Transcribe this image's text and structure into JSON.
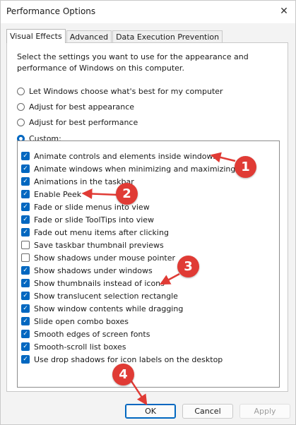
{
  "window": {
    "title": "Performance Options",
    "close_glyph": "✕"
  },
  "tabs": [
    {
      "label": "Visual Effects",
      "active": true
    },
    {
      "label": "Advanced",
      "active": false
    },
    {
      "label": "Data Execution Prevention",
      "active": false
    }
  ],
  "description": "Select the settings you want to use for the appearance and performance of Windows on this computer.",
  "radios": [
    {
      "label": "Let Windows choose what's best for my computer",
      "checked": false
    },
    {
      "label": "Adjust for best appearance",
      "checked": false
    },
    {
      "label": "Adjust for best performance",
      "checked": false
    },
    {
      "label": "Custom:",
      "checked": true
    }
  ],
  "options": [
    {
      "label": "Animate controls and elements inside windows",
      "checked": true
    },
    {
      "label": "Animate windows when minimizing and maximizing",
      "checked": true
    },
    {
      "label": "Animations in the taskbar",
      "checked": true
    },
    {
      "label": "Enable Peek",
      "checked": true
    },
    {
      "label": "Fade or slide menus into view",
      "checked": true
    },
    {
      "label": "Fade or slide ToolTips into view",
      "checked": true
    },
    {
      "label": "Fade out menu items after clicking",
      "checked": true
    },
    {
      "label": "Save taskbar thumbnail previews",
      "checked": false
    },
    {
      "label": "Show shadows under mouse pointer",
      "checked": false
    },
    {
      "label": "Show shadows under windows",
      "checked": true
    },
    {
      "label": "Show thumbnails instead of icons",
      "checked": true
    },
    {
      "label": "Show translucent selection rectangle",
      "checked": true
    },
    {
      "label": "Show window contents while dragging",
      "checked": true
    },
    {
      "label": "Slide open combo boxes",
      "checked": true
    },
    {
      "label": "Smooth edges of screen fonts",
      "checked": true
    },
    {
      "label": "Smooth-scroll list boxes",
      "checked": true
    },
    {
      "label": "Use drop shadows for icon labels on the desktop",
      "checked": true
    }
  ],
  "check_glyph": "✓",
  "buttons": {
    "ok": "OK",
    "cancel": "Cancel",
    "apply": "Apply"
  },
  "annotations": [
    "1",
    "2",
    "3",
    "4"
  ],
  "colors": {
    "accent": "#0067c0",
    "annotation": "#e03b35"
  }
}
